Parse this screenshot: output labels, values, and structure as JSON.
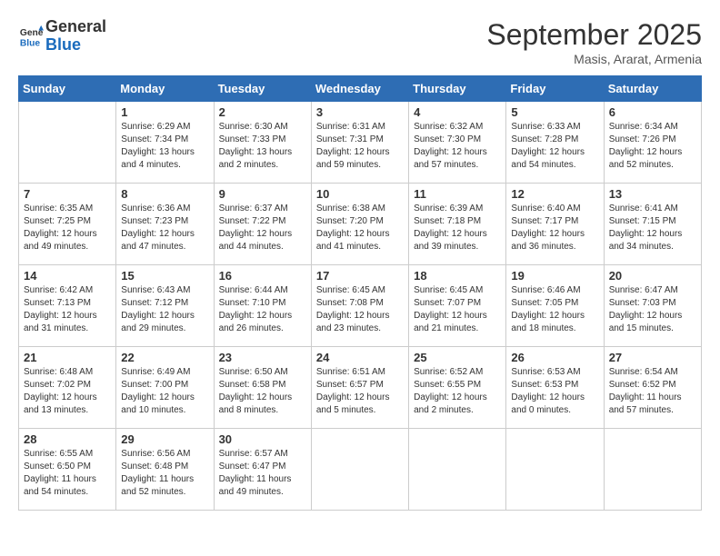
{
  "logo": {
    "line1": "General",
    "line2": "Blue"
  },
  "header": {
    "month": "September 2025",
    "location": "Masis, Ararat, Armenia"
  },
  "weekdays": [
    "Sunday",
    "Monday",
    "Tuesday",
    "Wednesday",
    "Thursday",
    "Friday",
    "Saturday"
  ],
  "weeks": [
    [
      {
        "day": "",
        "sunrise": "",
        "sunset": "",
        "daylight": ""
      },
      {
        "day": "1",
        "sunrise": "Sunrise: 6:29 AM",
        "sunset": "Sunset: 7:34 PM",
        "daylight": "Daylight: 13 hours and 4 minutes."
      },
      {
        "day": "2",
        "sunrise": "Sunrise: 6:30 AM",
        "sunset": "Sunset: 7:33 PM",
        "daylight": "Daylight: 13 hours and 2 minutes."
      },
      {
        "day": "3",
        "sunrise": "Sunrise: 6:31 AM",
        "sunset": "Sunset: 7:31 PM",
        "daylight": "Daylight: 12 hours and 59 minutes."
      },
      {
        "day": "4",
        "sunrise": "Sunrise: 6:32 AM",
        "sunset": "Sunset: 7:30 PM",
        "daylight": "Daylight: 12 hours and 57 minutes."
      },
      {
        "day": "5",
        "sunrise": "Sunrise: 6:33 AM",
        "sunset": "Sunset: 7:28 PM",
        "daylight": "Daylight: 12 hours and 54 minutes."
      },
      {
        "day": "6",
        "sunrise": "Sunrise: 6:34 AM",
        "sunset": "Sunset: 7:26 PM",
        "daylight": "Daylight: 12 hours and 52 minutes."
      }
    ],
    [
      {
        "day": "7",
        "sunrise": "Sunrise: 6:35 AM",
        "sunset": "Sunset: 7:25 PM",
        "daylight": "Daylight: 12 hours and 49 minutes."
      },
      {
        "day": "8",
        "sunrise": "Sunrise: 6:36 AM",
        "sunset": "Sunset: 7:23 PM",
        "daylight": "Daylight: 12 hours and 47 minutes."
      },
      {
        "day": "9",
        "sunrise": "Sunrise: 6:37 AM",
        "sunset": "Sunset: 7:22 PM",
        "daylight": "Daylight: 12 hours and 44 minutes."
      },
      {
        "day": "10",
        "sunrise": "Sunrise: 6:38 AM",
        "sunset": "Sunset: 7:20 PM",
        "daylight": "Daylight: 12 hours and 41 minutes."
      },
      {
        "day": "11",
        "sunrise": "Sunrise: 6:39 AM",
        "sunset": "Sunset: 7:18 PM",
        "daylight": "Daylight: 12 hours and 39 minutes."
      },
      {
        "day": "12",
        "sunrise": "Sunrise: 6:40 AM",
        "sunset": "Sunset: 7:17 PM",
        "daylight": "Daylight: 12 hours and 36 minutes."
      },
      {
        "day": "13",
        "sunrise": "Sunrise: 6:41 AM",
        "sunset": "Sunset: 7:15 PM",
        "daylight": "Daylight: 12 hours and 34 minutes."
      }
    ],
    [
      {
        "day": "14",
        "sunrise": "Sunrise: 6:42 AM",
        "sunset": "Sunset: 7:13 PM",
        "daylight": "Daylight: 12 hours and 31 minutes."
      },
      {
        "day": "15",
        "sunrise": "Sunrise: 6:43 AM",
        "sunset": "Sunset: 7:12 PM",
        "daylight": "Daylight: 12 hours and 29 minutes."
      },
      {
        "day": "16",
        "sunrise": "Sunrise: 6:44 AM",
        "sunset": "Sunset: 7:10 PM",
        "daylight": "Daylight: 12 hours and 26 minutes."
      },
      {
        "day": "17",
        "sunrise": "Sunrise: 6:45 AM",
        "sunset": "Sunset: 7:08 PM",
        "daylight": "Daylight: 12 hours and 23 minutes."
      },
      {
        "day": "18",
        "sunrise": "Sunrise: 6:45 AM",
        "sunset": "Sunset: 7:07 PM",
        "daylight": "Daylight: 12 hours and 21 minutes."
      },
      {
        "day": "19",
        "sunrise": "Sunrise: 6:46 AM",
        "sunset": "Sunset: 7:05 PM",
        "daylight": "Daylight: 12 hours and 18 minutes."
      },
      {
        "day": "20",
        "sunrise": "Sunrise: 6:47 AM",
        "sunset": "Sunset: 7:03 PM",
        "daylight": "Daylight: 12 hours and 15 minutes."
      }
    ],
    [
      {
        "day": "21",
        "sunrise": "Sunrise: 6:48 AM",
        "sunset": "Sunset: 7:02 PM",
        "daylight": "Daylight: 12 hours and 13 minutes."
      },
      {
        "day": "22",
        "sunrise": "Sunrise: 6:49 AM",
        "sunset": "Sunset: 7:00 PM",
        "daylight": "Daylight: 12 hours and 10 minutes."
      },
      {
        "day": "23",
        "sunrise": "Sunrise: 6:50 AM",
        "sunset": "Sunset: 6:58 PM",
        "daylight": "Daylight: 12 hours and 8 minutes."
      },
      {
        "day": "24",
        "sunrise": "Sunrise: 6:51 AM",
        "sunset": "Sunset: 6:57 PM",
        "daylight": "Daylight: 12 hours and 5 minutes."
      },
      {
        "day": "25",
        "sunrise": "Sunrise: 6:52 AM",
        "sunset": "Sunset: 6:55 PM",
        "daylight": "Daylight: 12 hours and 2 minutes."
      },
      {
        "day": "26",
        "sunrise": "Sunrise: 6:53 AM",
        "sunset": "Sunset: 6:53 PM",
        "daylight": "Daylight: 12 hours and 0 minutes."
      },
      {
        "day": "27",
        "sunrise": "Sunrise: 6:54 AM",
        "sunset": "Sunset: 6:52 PM",
        "daylight": "Daylight: 11 hours and 57 minutes."
      }
    ],
    [
      {
        "day": "28",
        "sunrise": "Sunrise: 6:55 AM",
        "sunset": "Sunset: 6:50 PM",
        "daylight": "Daylight: 11 hours and 54 minutes."
      },
      {
        "day": "29",
        "sunrise": "Sunrise: 6:56 AM",
        "sunset": "Sunset: 6:48 PM",
        "daylight": "Daylight: 11 hours and 52 minutes."
      },
      {
        "day": "30",
        "sunrise": "Sunrise: 6:57 AM",
        "sunset": "Sunset: 6:47 PM",
        "daylight": "Daylight: 11 hours and 49 minutes."
      },
      {
        "day": "",
        "sunrise": "",
        "sunset": "",
        "daylight": ""
      },
      {
        "day": "",
        "sunrise": "",
        "sunset": "",
        "daylight": ""
      },
      {
        "day": "",
        "sunrise": "",
        "sunset": "",
        "daylight": ""
      },
      {
        "day": "",
        "sunrise": "",
        "sunset": "",
        "daylight": ""
      }
    ]
  ]
}
